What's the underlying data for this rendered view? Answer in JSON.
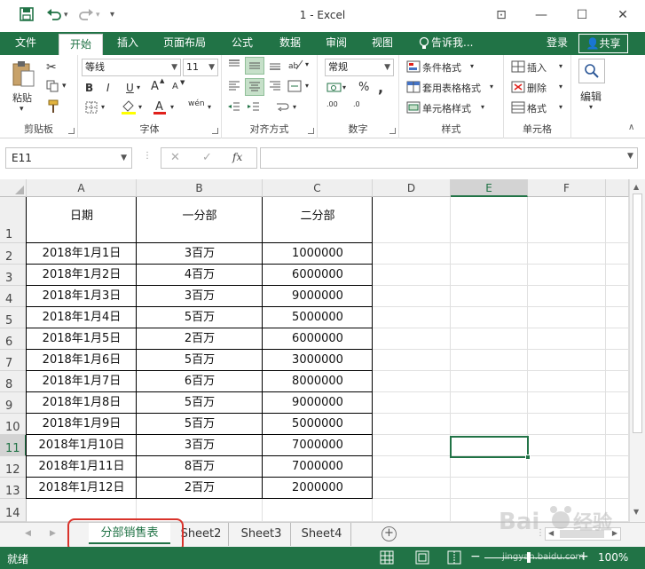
{
  "app": {
    "title": "1 - Excel"
  },
  "qat": {
    "save_icon": "save-icon",
    "undo_icon": "undo-icon",
    "redo_icon": "redo-icon",
    "customize": "▾"
  },
  "window": {
    "ribbon_display": "⊡",
    "minimize": "—",
    "maximize": "☐",
    "close": "✕"
  },
  "tabs": [
    "文件",
    "开始",
    "插入",
    "页面布局",
    "公式",
    "数据",
    "审阅",
    "视图"
  ],
  "tell_me": "告诉我...",
  "signin": "登录",
  "share": "共享",
  "clipboard": {
    "paste": "粘贴",
    "label": "剪贴板"
  },
  "font": {
    "name": "等线",
    "size": "11",
    "bold": "B",
    "italic": "I",
    "underline": "U",
    "grow": "A",
    "shrink": "A",
    "wen": "wén",
    "label": "字体"
  },
  "align": {
    "label": "对齐方式"
  },
  "number": {
    "format": "常规",
    "label": "数字",
    "pct": "%",
    "comma": ",",
    "inc": ".00",
    "dec": ".0"
  },
  "styles": {
    "cond": "条件格式",
    "table": "套用表格格式",
    "cell": "单元格样式",
    "label": "样式"
  },
  "cells": {
    "insert": "插入",
    "delete": "删除",
    "format": "格式",
    "label": "单元格"
  },
  "editing": {
    "label": "编辑"
  },
  "formula": {
    "namebox": "E11",
    "fx": "fx",
    "cancel": "✕",
    "enter": "✓",
    "value": ""
  },
  "columns": [
    "A",
    "B",
    "C",
    "D",
    "E",
    "F"
  ],
  "rows": [
    "1",
    "2",
    "3",
    "4",
    "5",
    "6",
    "7",
    "8",
    "9",
    "10",
    "11",
    "12",
    "13",
    "14"
  ],
  "table": {
    "headers": [
      "日期",
      "一分部",
      "二分部"
    ],
    "rows": [
      [
        "2018年1月1日",
        "3百万",
        "1000000"
      ],
      [
        "2018年1月2日",
        "4百万",
        "6000000"
      ],
      [
        "2018年1月3日",
        "3百万",
        "9000000"
      ],
      [
        "2018年1月4日",
        "5百万",
        "5000000"
      ],
      [
        "2018年1月5日",
        "2百万",
        "6000000"
      ],
      [
        "2018年1月6日",
        "5百万",
        "3000000"
      ],
      [
        "2018年1月7日",
        "6百万",
        "8000000"
      ],
      [
        "2018年1月8日",
        "5百万",
        "9000000"
      ],
      [
        "2018年1月9日",
        "5百万",
        "5000000"
      ],
      [
        "2018年1月10日",
        "3百万",
        "7000000"
      ],
      [
        "2018年1月11日",
        "8百万",
        "7000000"
      ],
      [
        "2018年1月12日",
        "2百万",
        "2000000"
      ]
    ]
  },
  "sheets": [
    "分部销售表",
    "Sheet2",
    "Sheet3",
    "Sheet4"
  ],
  "status": {
    "ready": "就绪",
    "zoom": "100%",
    "minus": "−",
    "plus": "+"
  },
  "colors": {
    "accent": "#217346",
    "annotation": "#d9332b",
    "selection": "#217346"
  },
  "watermark": "jingyan.baidu.com"
}
